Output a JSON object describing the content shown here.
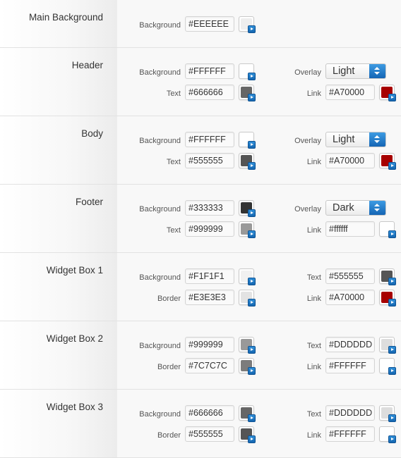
{
  "main_background": {
    "title": "Main Background",
    "background": {
      "label": "Background",
      "value": "#EEEEEE",
      "color": "#EEEEEE"
    }
  },
  "header": {
    "title": "Header",
    "background": {
      "label": "Background",
      "value": "#FFFFFF",
      "color": "#FFFFFF"
    },
    "text": {
      "label": "Text",
      "value": "#666666",
      "color": "#666666"
    },
    "overlay": {
      "label": "Overlay",
      "value": "Light"
    },
    "link": {
      "label": "Link",
      "value": "#A70000",
      "color": "#A70000"
    }
  },
  "body": {
    "title": "Body",
    "background": {
      "label": "Background",
      "value": "#FFFFFF",
      "color": "#FFFFFF"
    },
    "text": {
      "label": "Text",
      "value": "#555555",
      "color": "#555555"
    },
    "overlay": {
      "label": "Overlay",
      "value": "Light"
    },
    "link": {
      "label": "Link",
      "value": "#A70000",
      "color": "#A70000"
    }
  },
  "footer": {
    "title": "Footer",
    "background": {
      "label": "Background",
      "value": "#333333",
      "color": "#333333"
    },
    "text": {
      "label": "Text",
      "value": "#999999",
      "color": "#999999"
    },
    "overlay": {
      "label": "Overlay",
      "value": "Dark"
    },
    "link": {
      "label": "Link",
      "value": "#ffffff",
      "color": "#FFFFFF"
    }
  },
  "widget1": {
    "title": "Widget Box 1",
    "background": {
      "label": "Background",
      "value": "#F1F1F1",
      "color": "#F1F1F1"
    },
    "border": {
      "label": "Border",
      "value": "#E3E3E3",
      "color": "#E3E3E3"
    },
    "text": {
      "label": "Text",
      "value": "#555555",
      "color": "#555555"
    },
    "link": {
      "label": "Link",
      "value": "#A70000",
      "color": "#A70000"
    }
  },
  "widget2": {
    "title": "Widget Box 2",
    "background": {
      "label": "Background",
      "value": "#999999",
      "color": "#999999"
    },
    "border": {
      "label": "Border",
      "value": "#7C7C7C",
      "color": "#7C7C7C"
    },
    "text": {
      "label": "Text",
      "value": "#DDDDDD",
      "color": "#DDDDDD"
    },
    "link": {
      "label": "Link",
      "value": "#FFFFFF",
      "color": "#FFFFFF"
    }
  },
  "widget3": {
    "title": "Widget Box 3",
    "background": {
      "label": "Background",
      "value": "#666666",
      "color": "#666666"
    },
    "border": {
      "label": "Border",
      "value": "#555555",
      "color": "#555555"
    },
    "text": {
      "label": "Text",
      "value": "#DDDDDD",
      "color": "#DDDDDD"
    },
    "link": {
      "label": "Link",
      "value": "#FFFFFF",
      "color": "#FFFFFF"
    }
  },
  "icons": {
    "picker_arrow": "play-arrow-icon",
    "select_arrows": "up-down-arrows-icon"
  }
}
